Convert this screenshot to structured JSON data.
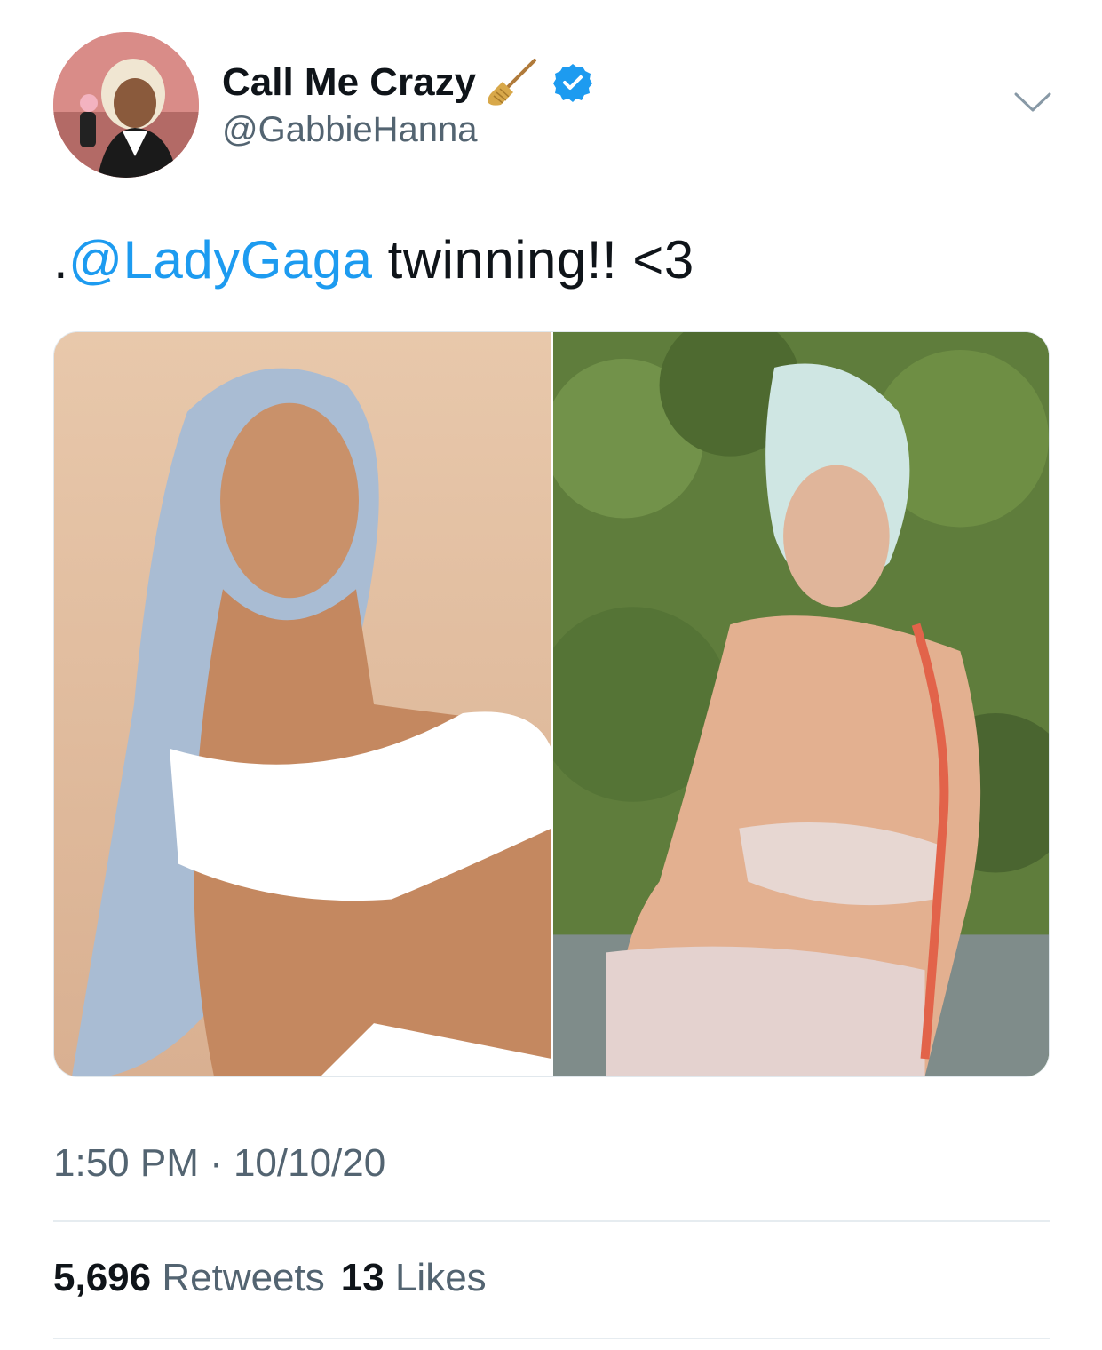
{
  "author": {
    "display_name": "Call Me Crazy",
    "name_emoji": "broom-icon",
    "verified": true,
    "handle": "@GabbieHanna"
  },
  "tweet": {
    "prefix": ".",
    "mention": "@LadyGaga",
    "text": " twinning!! <3"
  },
  "media": {
    "images": [
      "photo-left",
      "photo-right"
    ]
  },
  "meta": {
    "timestamp": "1:50 PM · 10/10/20"
  },
  "stats": {
    "retweets_count": "5,696",
    "retweets_label": "Retweets",
    "likes_count": "13",
    "likes_label": "Likes"
  },
  "colors": {
    "link": "#1d9bf0",
    "verified": "#1d9bf0",
    "secondary_text": "#536471",
    "primary_text": "#0f1419"
  }
}
